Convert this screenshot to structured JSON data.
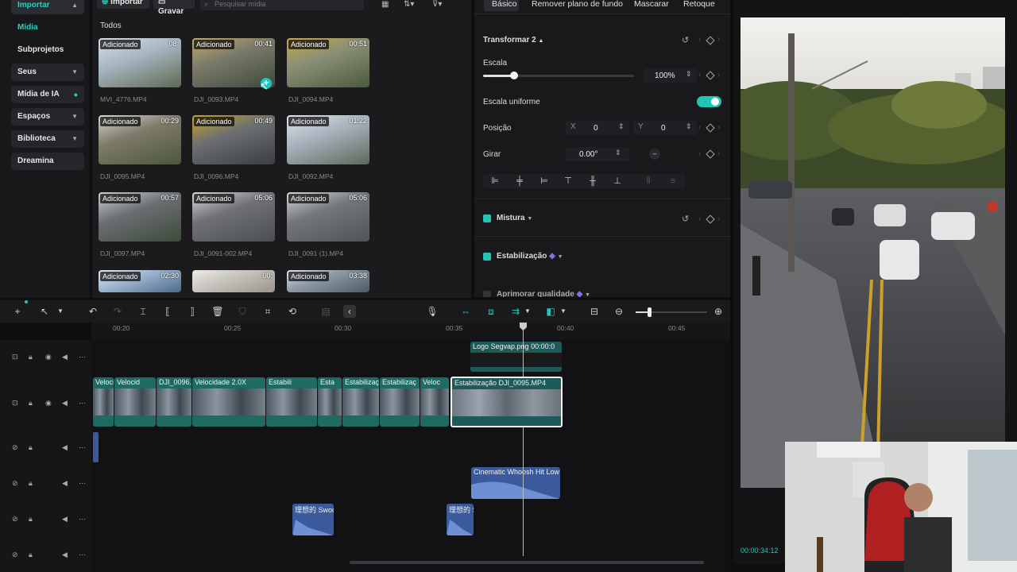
{
  "nav": {
    "items": [
      {
        "label": "Importar",
        "chevron": true
      },
      {
        "label": "Mídia",
        "chevron": false
      },
      {
        "label": "Subprojetos",
        "chevron": false
      },
      {
        "label": "Seus",
        "chevron": true
      },
      {
        "label": "Mídia de IA",
        "chevron": false
      },
      {
        "label": "Espaços",
        "chevron": true
      },
      {
        "label": "Biblioteca",
        "chevron": true
      },
      {
        "label": "Dreamina",
        "chevron": false
      }
    ]
  },
  "media": {
    "import_label": "Importar",
    "record_label": "Gravar",
    "search_placeholder": "Pesquisar mídia",
    "section_title": "Todos",
    "added_tag": "Adicionado",
    "clips": [
      {
        "name": "MVI_4776.MP4",
        "duration": "08:"
      },
      {
        "name": "DJI_0093.MP4",
        "duration": "00:41"
      },
      {
        "name": "DJI_0094.MP4",
        "duration": "00:51"
      },
      {
        "name": "DJI_0095.MP4",
        "duration": "00:29"
      },
      {
        "name": "DJI_0096.MP4",
        "duration": "00:49"
      },
      {
        "name": "DJI_0092.MP4",
        "duration": "01:22"
      },
      {
        "name": "DJI_0097.MP4",
        "duration": "00:57"
      },
      {
        "name": "DJI_0091-002.MP4",
        "duration": "05:06"
      },
      {
        "name": "DJI_0091 (1).MP4",
        "duration": "05:06"
      },
      {
        "name": "",
        "duration": "02:30"
      },
      {
        "name": "",
        "duration": "00:"
      },
      {
        "name": "",
        "duration": "03:38"
      }
    ]
  },
  "props": {
    "tabs": [
      "Básico",
      "Remover plano de fundo",
      "Mascarar",
      "Retoque"
    ],
    "transform_title": "Transformar 2",
    "scale_label": "Escala",
    "scale_value": "100%",
    "uniform_scale_label": "Escala uniforme",
    "position_label": "Posição",
    "x_label": "X",
    "x_value": "0",
    "y_label": "Y",
    "y_value": "0",
    "rotate_label": "Girar",
    "rotate_value": "0.00°",
    "mix_label": "Mistura",
    "stabilize_label": "Estabilização",
    "enhance_label": "Aprimorar qualidade",
    "accent": "#20c6b8"
  },
  "preview": {
    "timecode": "00:00:34:12"
  },
  "timeline": {
    "ruler": [
      "00:20",
      "00:25",
      "00:30",
      "00:35",
      "00:40",
      "00:45"
    ],
    "overlay_clip": {
      "name": "Logo Segvap.png",
      "time": "00:00:0"
    },
    "video_clips": [
      {
        "label": "Veloci"
      },
      {
        "label": "Velocid"
      },
      {
        "label": "DJI_0096.I"
      },
      {
        "label": "Velocidade 2.0X"
      },
      {
        "label": "Estabili"
      },
      {
        "label": "Esta"
      },
      {
        "label": "Estabilizaç"
      },
      {
        "label": "Estabilizaç"
      },
      {
        "label": "Veloc"
      },
      {
        "label": "Estabilização"
      },
      {
        "label": "DJI_0095.MP4"
      }
    ],
    "audio_clips": [
      {
        "label": "Cinematic Whoosh Hit Low"
      },
      {
        "label": "理想的 Swoo"
      },
      {
        "label": "理想的 S"
      }
    ]
  }
}
